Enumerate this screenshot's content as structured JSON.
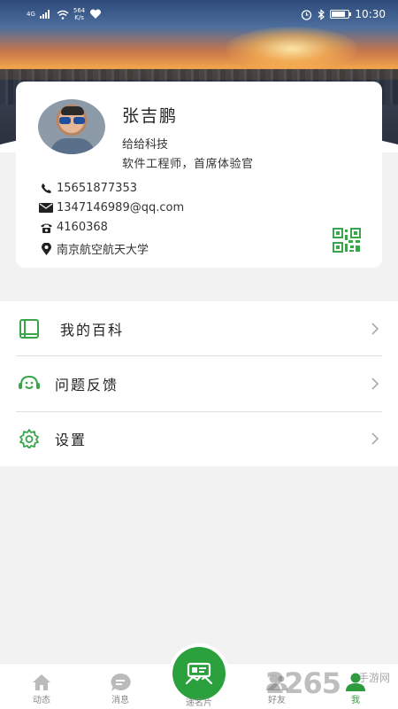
{
  "status_bar": {
    "network": "4G",
    "speed_value": "564",
    "speed_unit": "K/s",
    "time": "10:30",
    "battery_level": 0.85
  },
  "profile": {
    "name": "张吉鹏",
    "company": "给给科技",
    "title": "软件工程师，首席体验官",
    "phone": "15651877353",
    "email": "1347146989@qq.com",
    "telephone": "4160368",
    "address": "南京航空航天大学"
  },
  "menu": {
    "items": [
      {
        "label": "我的百科",
        "icon": "book-icon"
      },
      {
        "label": "问题反馈",
        "icon": "headset-icon"
      },
      {
        "label": "设置",
        "icon": "gear-icon"
      }
    ]
  },
  "tabbar": {
    "tabs": [
      {
        "label": "动态",
        "icon": "home-icon"
      },
      {
        "label": "消息",
        "icon": "message-icon"
      },
      {
        "label": "递名片",
        "icon": "card-share-icon"
      },
      {
        "label": "好友",
        "icon": "friends-icon"
      },
      {
        "label": "我",
        "icon": "me-icon"
      }
    ],
    "active_color": "#2e9c3e"
  },
  "watermark": {
    "number": "2265",
    "text": "手游网"
  },
  "colors": {
    "accent": "#2aa13d",
    "icon_green": "#3aa54a"
  }
}
